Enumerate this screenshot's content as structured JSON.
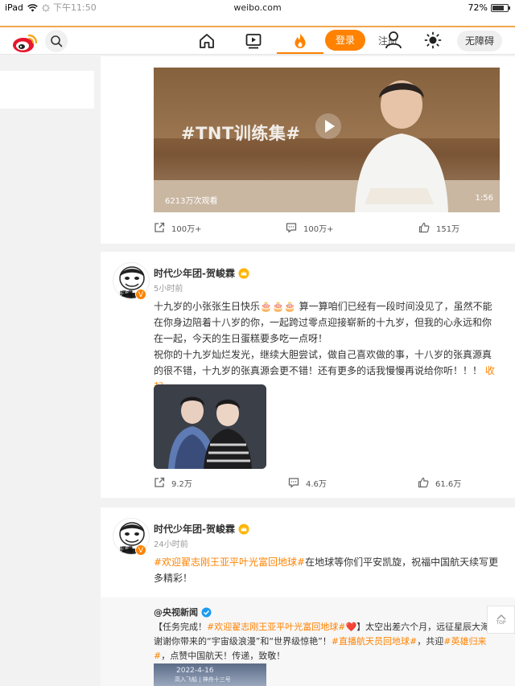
{
  "status_bar": {
    "device": "iPad",
    "time": "下午11:50",
    "url": "weibo.com",
    "battery": "72%",
    "battery_level": 0.72
  },
  "nav": {
    "login_label": "登录",
    "register_label": "注册",
    "accessibility_label": "无障碍"
  },
  "feed": [
    {
      "type": "video",
      "video_tag": "#TNT训练集#",
      "views": "6213万次观看",
      "duration": "1:56",
      "repost_count": "100万+",
      "comment_count": "100万+",
      "like_count": "151万"
    },
    {
      "type": "post",
      "author": "时代少年团-贺峻霖",
      "time": "5小时前",
      "avatar_text": "嘿嘿",
      "text_p1": "十九岁的小张张生日快乐🎂🎂🎂 算一算咱们已经有一段时间没见了，虽然不能在你身边陪着十八岁的你，一起跨过零点迎接崭新的十九岁，但我的心永远和你在一起，今天的生日蛋糕要多吃一点呀！",
      "text_p2": "祝你的十九岁灿烂发光，继续大胆尝试，做自己喜欢做的事，十八岁的张真源真的很不错，十九岁的张真源会更不错！还有更多的话我慢慢再说给你听！！！",
      "collapse_label": "收起",
      "repost_count": "9.2万",
      "comment_count": "4.6万",
      "like_count": "61.6万"
    },
    {
      "type": "repost",
      "author": "时代少年团-贺峻霖",
      "time": "24小时前",
      "avatar_text": "嘿嘿",
      "hashtag": "#欢迎翟志刚王亚平叶光富回地球#",
      "text_rest": "在地球等你们平安凯旋，祝福中国航天续写更多精彩！",
      "repost": {
        "author": "@央视新闻",
        "t_prefix": "【任务完成！",
        "t_tag1": "#欢迎翟志刚王亚平叶光富回地球#",
        "t_mid1": "❤️】太空出差六个月，远征星辰大海。谢谢你带来的“宇宙级浪漫”和“世界级惊艳”！",
        "t_tag2": "#直播航天员回地球#",
        "t_mid2": "，共迎",
        "t_tag3": "#英雄归来#",
        "t_end": "，点赞中国航天！传递，致敬！",
        "image_date": "2022-4-16",
        "image_sub": "高入飞船 | 神舟十三号"
      }
    }
  ],
  "back_to_top_label": "TOP"
}
